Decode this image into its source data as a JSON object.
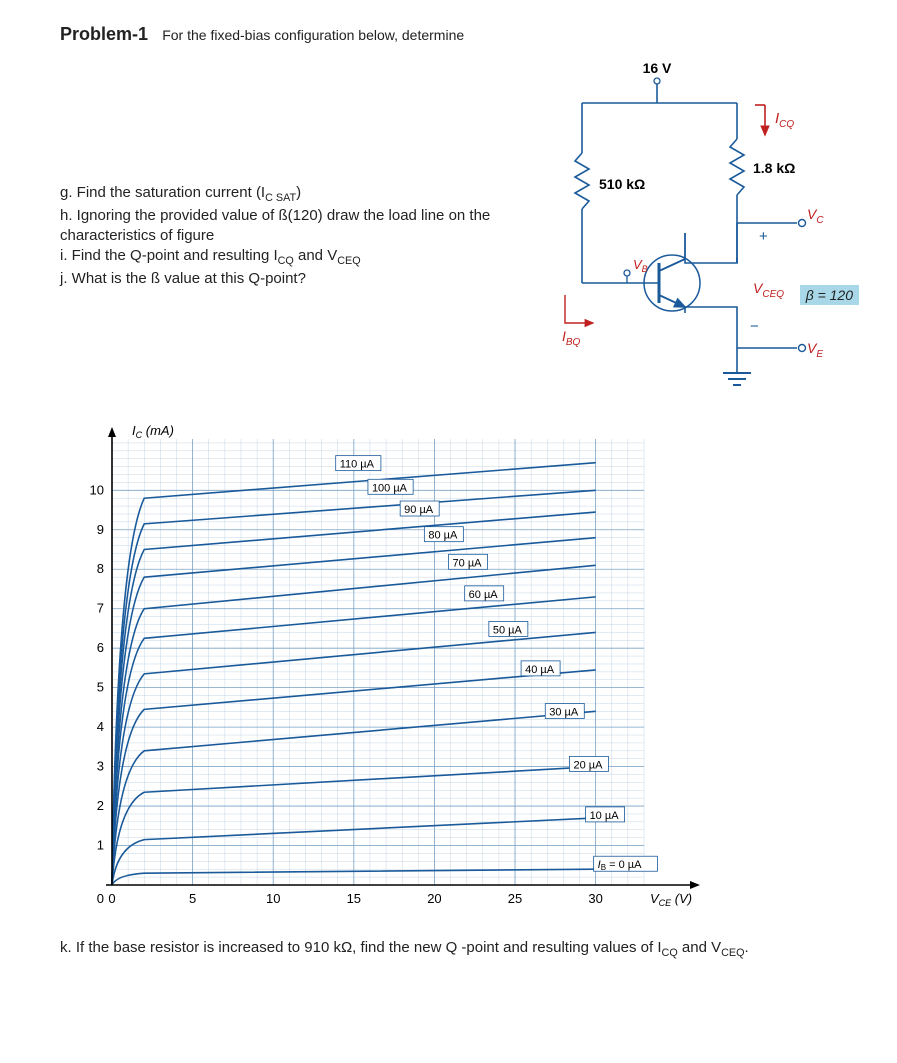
{
  "header": {
    "title_prefix": "Problem-1",
    "title_rest": "For the fixed-bias configuration below, determine"
  },
  "questions": {
    "g": "g. Find the saturation current (I",
    "g_sub": "C SAT",
    "g_end": ")",
    "h": "h. Ignoring the provided value of ß(120) draw the load line on the characteristics of figure",
    "i_pre": "i. Find the Q-point and resulting I",
    "i_sub1": "CQ",
    "i_mid": " and V",
    "i_sub2": "CEQ",
    "j": "j. What is the ß value at this Q-point?",
    "k_pre": "k. If the base resistor is increased to 910 kΩ, find the new Q -point and resulting values of I",
    "k_sub1": "CQ",
    "k_mid": " and V",
    "k_sub2": "CEQ",
    "k_end": "."
  },
  "circuit": {
    "vcc": "16 V",
    "rb": "510 kΩ",
    "rc": "1.8 kΩ",
    "icq": "I",
    "icq_sub": "CQ",
    "vc": "V",
    "vc_sub": "C",
    "vceq": "V",
    "vceq_sub": "CEQ",
    "ve": "V",
    "ve_sub": "E",
    "ibq": "I",
    "ibq_sub": "BQ",
    "vb": "V",
    "vb_sub": "B",
    "beta": "β = 120"
  },
  "chart_data": {
    "type": "line",
    "title": "",
    "xlabel": "V_CE (V)",
    "ylabel": "I_C (mA)",
    "xlim": [
      0,
      33
    ],
    "ylim": [
      0,
      11.3
    ],
    "x_ticks": [
      0,
      5,
      10,
      15,
      20,
      25,
      30
    ],
    "y_ticks": [
      0,
      1,
      2,
      3,
      4,
      5,
      6,
      7,
      8,
      9,
      10
    ],
    "series": [
      {
        "name": "IB = 0 µA",
        "x": [
          0.3,
          2,
          30
        ],
        "y": [
          0.1,
          0.3,
          0.4
        ]
      },
      {
        "name": "10 µA",
        "x": [
          0.3,
          2,
          30
        ],
        "y": [
          0.6,
          1.15,
          1.7
        ]
      },
      {
        "name": "20 µA",
        "x": [
          0.3,
          2,
          30
        ],
        "y": [
          1.3,
          2.35,
          3.0
        ]
      },
      {
        "name": "30 µA",
        "x": [
          0.3,
          2,
          30
        ],
        "y": [
          2.1,
          3.4,
          4.4
        ]
      },
      {
        "name": "40 µA",
        "x": [
          0.3,
          2,
          30
        ],
        "y": [
          2.9,
          4.45,
          5.45
        ]
      },
      {
        "name": "50 µA",
        "x": [
          0.3,
          2,
          30
        ],
        "y": [
          3.6,
          5.35,
          6.4
        ]
      },
      {
        "name": "60 µA",
        "x": [
          0.3,
          2,
          30
        ],
        "y": [
          4.3,
          6.25,
          7.3
        ]
      },
      {
        "name": "70 µA",
        "x": [
          0.3,
          2,
          30
        ],
        "y": [
          5.0,
          7.0,
          8.1
        ]
      },
      {
        "name": "80 µA",
        "x": [
          0.3,
          2,
          30
        ],
        "y": [
          5.6,
          7.8,
          8.8
        ]
      },
      {
        "name": "90 µA",
        "x": [
          0.3,
          2,
          30
        ],
        "y": [
          6.2,
          8.5,
          9.45
        ]
      },
      {
        "name": "100 µA",
        "x": [
          0.3,
          2,
          30
        ],
        "y": [
          6.8,
          9.15,
          10.0
        ]
      },
      {
        "name": "110 µA",
        "x": [
          0.3,
          2,
          30
        ],
        "y": [
          7.4,
          9.8,
          10.7
        ]
      }
    ],
    "curve_labels": [
      {
        "text": "110 µA",
        "x": 14,
        "y": 10.6
      },
      {
        "text": "100 µA",
        "x": 16,
        "y": 10.0
      },
      {
        "text": "90 µA",
        "x": 18,
        "y": 9.45
      },
      {
        "text": "80 µA",
        "x": 19.5,
        "y": 8.8
      },
      {
        "text": "70 µA",
        "x": 21,
        "y": 8.1
      },
      {
        "text": "60 µA",
        "x": 22,
        "y": 7.3
      },
      {
        "text": "50 µA",
        "x": 23.5,
        "y": 6.4
      },
      {
        "text": "40 µA",
        "x": 25.5,
        "y": 5.4
      },
      {
        "text": "30 µA",
        "x": 27,
        "y": 4.32
      },
      {
        "text": "20 µA",
        "x": 28.5,
        "y": 2.98
      },
      {
        "text": "10 µA",
        "x": 29.5,
        "y": 1.7
      },
      {
        "text": "IB = 0 µA",
        "x": 30,
        "y": 0.45
      }
    ]
  }
}
